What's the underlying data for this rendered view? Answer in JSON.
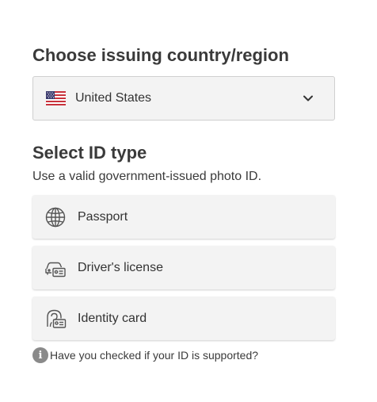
{
  "country": {
    "heading": "Choose issuing country/region",
    "selected": "United States",
    "flag_icon": "us-flag-icon",
    "dropdown_icon": "chevron-down-icon"
  },
  "id_type": {
    "heading": "Select ID type",
    "subtext": "Use a valid government-issued photo ID.",
    "options": [
      {
        "label": "Passport",
        "icon": "globe-icon"
      },
      {
        "label": "Driver's license",
        "icon": "car-license-icon"
      },
      {
        "label": "Identity card",
        "icon": "identity-card-icon"
      }
    ]
  },
  "help": {
    "icon": "info-icon",
    "text": "Have you checked if your ID is supported?"
  },
  "colors": {
    "background": "#ffffff",
    "panel": "#f3f3f3",
    "text": "#333333",
    "info_icon": "#8a8a8a"
  }
}
